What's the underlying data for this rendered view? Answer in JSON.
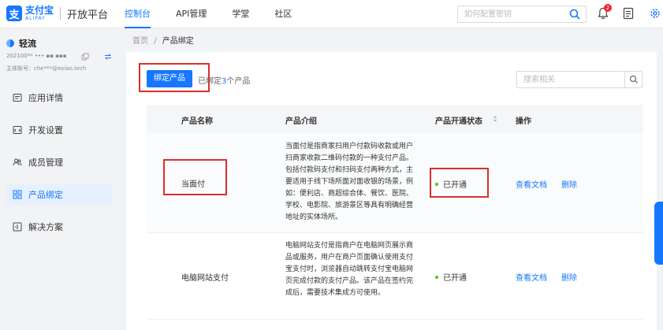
{
  "brand": {
    "logo_char": "支",
    "cn": "支付宝",
    "en": "ALIPAY",
    "platform": "开放平台"
  },
  "nav": [
    {
      "label": "控制台",
      "active": true
    },
    {
      "label": "API管理",
      "active": false
    },
    {
      "label": "学堂",
      "active": false
    },
    {
      "label": "社区",
      "active": false
    }
  ],
  "top_search": {
    "placeholder": "如何配置密钥"
  },
  "notifications": {
    "count": "2"
  },
  "sidebar": {
    "app_name": "轻流",
    "app_id": "202100** ••• ▪▪ ▪▪▪",
    "app_acct": "主体账号：che***@exiao.tech",
    "menu": [
      {
        "label": "应用详情",
        "icon": "app-detail-icon",
        "active": false
      },
      {
        "label": "开发设置",
        "icon": "dev-settings-icon",
        "active": false
      },
      {
        "label": "成员管理",
        "icon": "members-icon",
        "active": false
      },
      {
        "label": "产品绑定",
        "icon": "product-bind-icon",
        "active": true
      },
      {
        "label": "解决方案",
        "icon": "solution-icon",
        "active": false
      }
    ]
  },
  "breadcrumb": {
    "home": "首页",
    "sep": "/",
    "current": "产品绑定"
  },
  "toolbar": {
    "bind_label": "绑定产品",
    "bound_prefix": "已绑定",
    "bound_count": "3",
    "bound_suffix": "个产品",
    "search_placeholder": "搜索相关"
  },
  "table": {
    "headers": {
      "name": "产品名称",
      "intro": "产品介绍",
      "status": "产品开通状态",
      "ops": "操作"
    },
    "rows": [
      {
        "name": "当面付",
        "intro": "当面付是指商家扫用户付款码收款或用户扫商家收款二维码付款的一种支付产品。包括付款码支付和扫码支付两种方式，主要适用于线下场所面对面收银的场景，例如：便利店、商超综合体、餐饮、医院、学校、电影院、旅游景区等具有明确经营地址的实体场所。",
        "status": "已开通",
        "op_doc": "查看文档",
        "op_del": "删除"
      },
      {
        "name": "电脑网站支付",
        "intro": "电脑网站支付是指商户在电脑网页展示商品或服务，用户在商户页面确认使用支付宝支付时，浏览器自动跳转支付宝电脑网页完成付款的支付产品。该产品在签约完成后，需要技术集成方可使用。",
        "status": "已开通",
        "op_doc": "查看文档",
        "op_del": "删除"
      }
    ]
  },
  "colors": {
    "primary": "#1677ff",
    "highlight": "#d9302c",
    "status_ok": "#52c41a"
  }
}
